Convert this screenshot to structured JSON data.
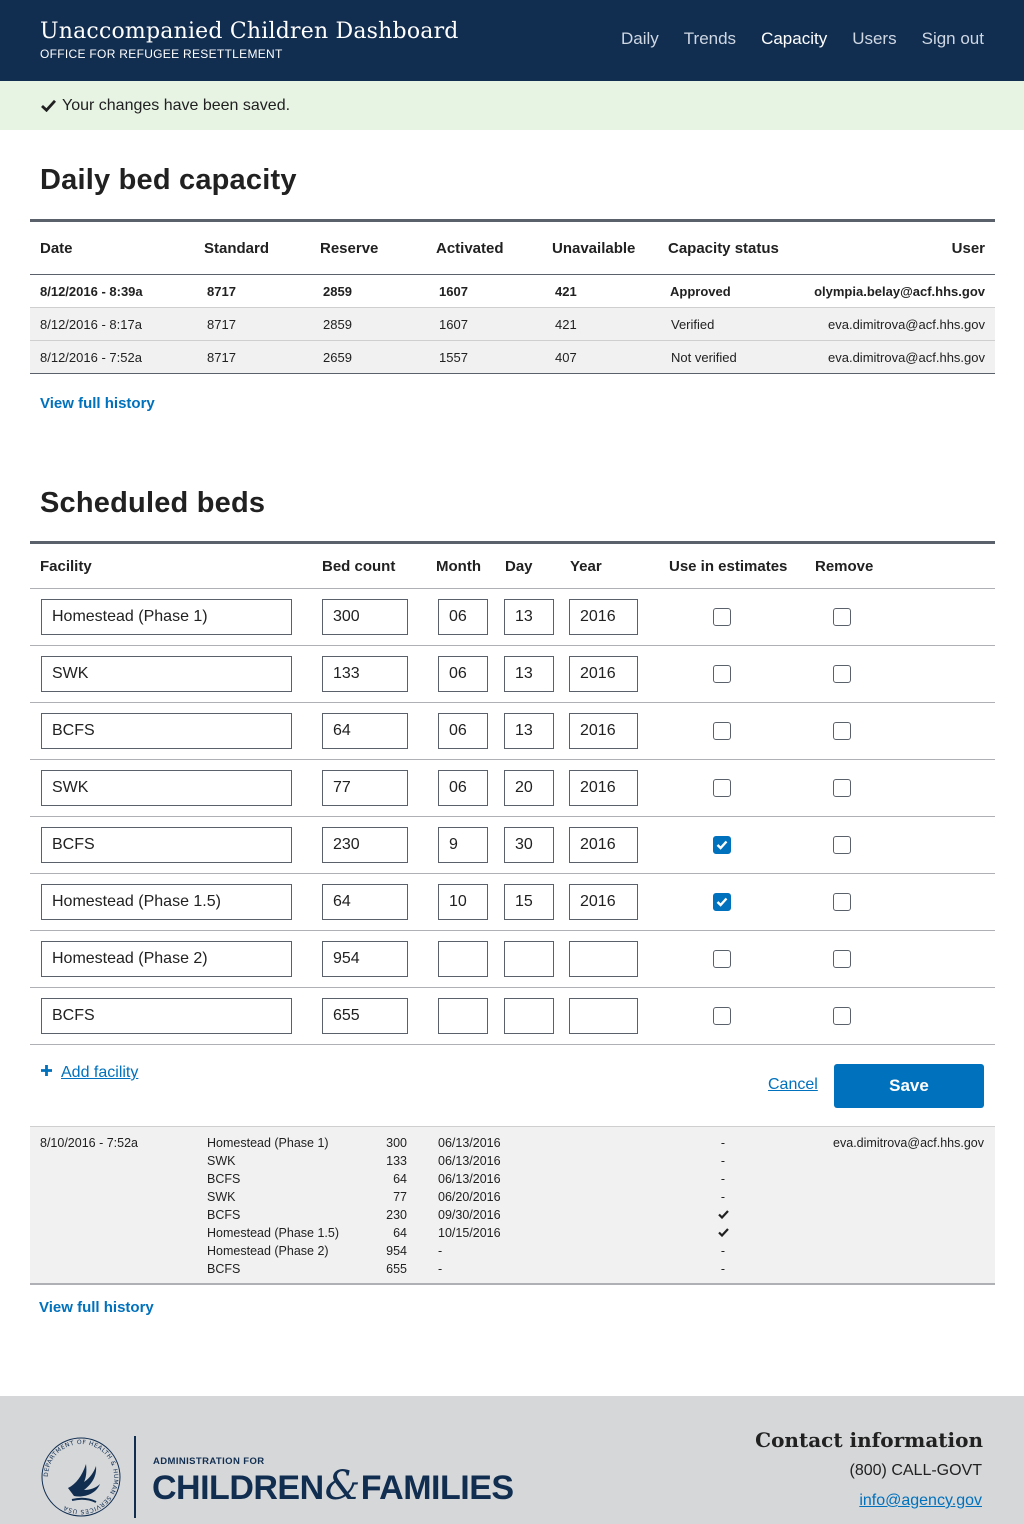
{
  "header": {
    "title": "Unaccompanied Children Dashboard",
    "subtitle": "OFFICE FOR REFUGEE RESETTLEMENT",
    "nav": [
      {
        "label": "Daily",
        "active": false
      },
      {
        "label": "Trends",
        "active": false
      },
      {
        "label": "Capacity",
        "active": true
      },
      {
        "label": "Users",
        "active": false
      },
      {
        "label": "Sign out",
        "active": false
      }
    ]
  },
  "alert": {
    "message": "Your changes have been saved.",
    "icon": "check-icon"
  },
  "capacity": {
    "heading": "Daily bed capacity",
    "columns": [
      "Date",
      "Standard",
      "Reserve",
      "Activated",
      "Unavailable",
      "Capacity status",
      "User"
    ],
    "rows": [
      [
        "8/12/2016 - 8:39a",
        "8717",
        "2859",
        "1607",
        "421",
        "Approved",
        "olympia.belay@acf.hhs.gov"
      ],
      [
        "8/12/2016 - 8:17a",
        "8717",
        "2859",
        "1607",
        "421",
        "Verified",
        "eva.dimitrova@acf.hhs.gov"
      ],
      [
        "8/12/2016 - 7:52a",
        "8717",
        "2659",
        "1557",
        "407",
        "Not verified",
        "eva.dimitrova@acf.hhs.gov"
      ]
    ],
    "history_link": "View full history"
  },
  "scheduled": {
    "heading": "Scheduled beds",
    "columns": [
      "Facility",
      "Bed count",
      "Month",
      "Day",
      "Year",
      "Use in estimates",
      "Remove"
    ],
    "rows": [
      {
        "facility": "Homestead (Phase 1)",
        "beds": "300",
        "month": "06",
        "day": "13",
        "year": "2016",
        "use": false,
        "remove": false
      },
      {
        "facility": "SWK",
        "beds": "133",
        "month": "06",
        "day": "13",
        "year": "2016",
        "use": false,
        "remove": false
      },
      {
        "facility": "BCFS",
        "beds": "64",
        "month": "06",
        "day": "13",
        "year": "2016",
        "use": false,
        "remove": false
      },
      {
        "facility": "SWK",
        "beds": "77",
        "month": "06",
        "day": "20",
        "year": "2016",
        "use": false,
        "remove": false
      },
      {
        "facility": "BCFS",
        "beds": "230",
        "month": "9",
        "day": "30",
        "year": "2016",
        "use": true,
        "remove": false
      },
      {
        "facility": "Homestead (Phase 1.5)",
        "beds": "64",
        "month": "10",
        "day": "15",
        "year": "2016",
        "use": true,
        "remove": false
      },
      {
        "facility": "Homestead (Phase 2)",
        "beds": "954",
        "month": "",
        "day": "",
        "year": "",
        "use": false,
        "remove": false
      },
      {
        "facility": "BCFS",
        "beds": "655",
        "month": "",
        "day": "",
        "year": "",
        "use": false,
        "remove": false
      }
    ],
    "add_label": "Add facility",
    "cancel_label": "Cancel",
    "save_label": "Save",
    "history": {
      "date": "8/10/2016 - 7:52a",
      "user": "eva.dimitrova@acf.hhs.gov",
      "entries": [
        {
          "facility": "Homestead (Phase 1)",
          "beds": "300",
          "date": "06/13/2016",
          "est": "-"
        },
        {
          "facility": "SWK",
          "beds": "133",
          "date": "06/13/2016",
          "est": "-"
        },
        {
          "facility": "BCFS",
          "beds": "64",
          "date": "06/13/2016",
          "est": "-"
        },
        {
          "facility": "SWK",
          "beds": "77",
          "date": "06/20/2016",
          "est": "-"
        },
        {
          "facility": "BCFS",
          "beds": "230",
          "date": "09/30/2016",
          "est": "check"
        },
        {
          "facility": "Homestead (Phase 1.5)",
          "beds": "64",
          "date": "10/15/2016",
          "est": "check"
        },
        {
          "facility": "Homestead (Phase 2)",
          "beds": "954",
          "date": "-",
          "est": "-"
        },
        {
          "facility": "BCFS",
          "beds": "655",
          "date": "-",
          "est": "-"
        }
      ]
    },
    "history_link": "View full history"
  },
  "footer": {
    "logo_small": "ADMINISTRATION FOR",
    "logo_left": "CHILDREN",
    "logo_amp": "&",
    "logo_right": "FAMILIES",
    "seal_text": "DEPARTMENT OF HEALTH & HUMAN SERVICES USA",
    "contact_title": "Contact information",
    "phone": "(800) CALL-GOVT",
    "email": "info@agency.gov"
  },
  "colors": {
    "header": "#112e51",
    "link": "#0071bc",
    "alert": "#e7f4e4",
    "footer": "#d6d7d9"
  }
}
